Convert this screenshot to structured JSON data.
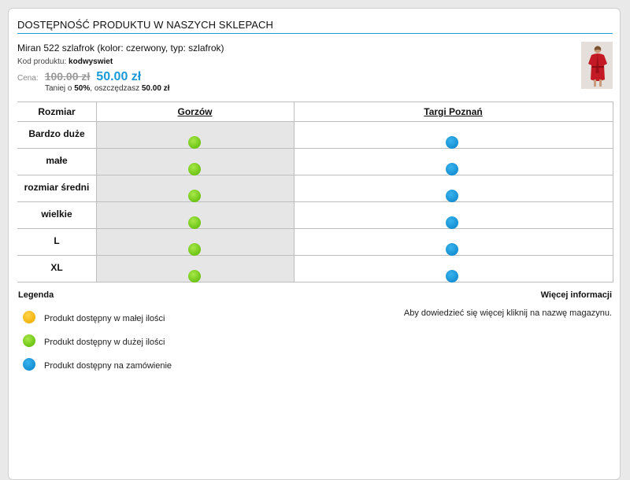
{
  "header": {
    "title": "DOSTĘPNOŚĆ PRODUKTU W NASZYCH SKLEPACH"
  },
  "product": {
    "name": "Miran 522 szlafrok (kolor: czerwony, typ: szlafrok)",
    "code_label": "Kod produktu:",
    "code_value": "kodwyswiet",
    "price_label": "Cena:",
    "old_price": "100.00 zł",
    "new_price": "50.00 zł",
    "saving_prefix": "Taniej o",
    "saving_percent": "50%",
    "saving_middle": ", oszczędzasz",
    "saving_amount": "50.00 zł"
  },
  "table": {
    "size_header": "Rozmiar",
    "stores": [
      "Gorzów",
      "Targi Poznań"
    ],
    "rows": [
      {
        "size": "Bardzo duże",
        "availability": [
          "green",
          "blue"
        ]
      },
      {
        "size": "małe",
        "availability": [
          "green",
          "blue"
        ]
      },
      {
        "size": "rozmiar średni",
        "availability": [
          "green",
          "blue"
        ]
      },
      {
        "size": "wielkie",
        "availability": [
          "green",
          "blue"
        ]
      },
      {
        "size": "L",
        "availability": [
          "green",
          "blue"
        ]
      },
      {
        "size": "XL",
        "availability": [
          "green",
          "blue"
        ]
      }
    ]
  },
  "legend": {
    "title": "Legenda",
    "items": [
      {
        "color": "yellow",
        "label": "Produkt dostępny w małej ilości"
      },
      {
        "color": "green",
        "label": "Produkt dostępny w dużej ilości"
      },
      {
        "color": "blue",
        "label": "Produkt dostępny na zamówienie"
      }
    ]
  },
  "info": {
    "title": "Więcej informacji",
    "text": "Aby dowiedzieć się więcej kliknij na nazwę magazynu."
  },
  "colors": {
    "accent": "#1a9ad6",
    "green": "#6cc414",
    "blue": "#1690d2",
    "yellow": "#f2b30f",
    "column_highlight": "#e6e6e6"
  }
}
